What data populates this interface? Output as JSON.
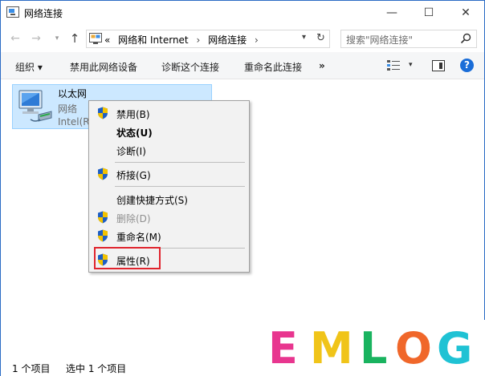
{
  "window": {
    "title": "网络连接",
    "min_glyph": "—",
    "max_glyph": "☐",
    "close_glyph": "✕"
  },
  "nav": {
    "back_glyph": "←",
    "forward_glyph": "→",
    "recent_glyph": "▾",
    "up_glyph": "↑",
    "address": {
      "overflow": "«",
      "crumbs": [
        "网络和 Internet",
        "网络连接"
      ],
      "separator": "›",
      "dropdown_glyph": "▾",
      "refresh_glyph": "↻"
    },
    "search": {
      "placeholder": "搜索\"网络连接\""
    }
  },
  "commands": {
    "organize": "组织 ▾",
    "disable": "禁用此网络设备",
    "diagnose": "诊断这个连接",
    "rename": "重命名此连接",
    "more": "»",
    "view_dropdown": "▾",
    "help": "?"
  },
  "item": {
    "name": "以太网",
    "status": "网络",
    "adapter": "Intel(R)"
  },
  "context_menu": {
    "items": [
      {
        "label": "禁用(B)",
        "shield": true,
        "bold": false,
        "disabled": false
      },
      {
        "label": "状态(U)",
        "shield": false,
        "bold": true,
        "disabled": false
      },
      {
        "label": "诊断(I)",
        "shield": false,
        "bold": false,
        "disabled": false
      },
      {
        "label": "桥接(G)",
        "shield": true,
        "bold": false,
        "disabled": false
      },
      {
        "label": "创建快捷方式(S)",
        "shield": false,
        "bold": false,
        "disabled": false
      },
      {
        "label": "删除(D)",
        "shield": true,
        "bold": false,
        "disabled": true
      },
      {
        "label": "重命名(M)",
        "shield": true,
        "bold": false,
        "disabled": false
      },
      {
        "label": "属性(R)",
        "shield": true,
        "bold": false,
        "disabled": false
      }
    ]
  },
  "status": {
    "count": "1 个项目",
    "selected": "选中 1 个项目"
  },
  "watermark": {
    "letters": [
      "E",
      "M",
      "L",
      "O",
      "G"
    ],
    "colors": [
      "#e8368f",
      "#f0c419",
      "#19b35f",
      "#f0672a",
      "#1fc2d4"
    ]
  },
  "colors": {
    "accent": "#1a6dd8",
    "selection": "#cce8ff",
    "highlight_border": "#e0242d"
  }
}
